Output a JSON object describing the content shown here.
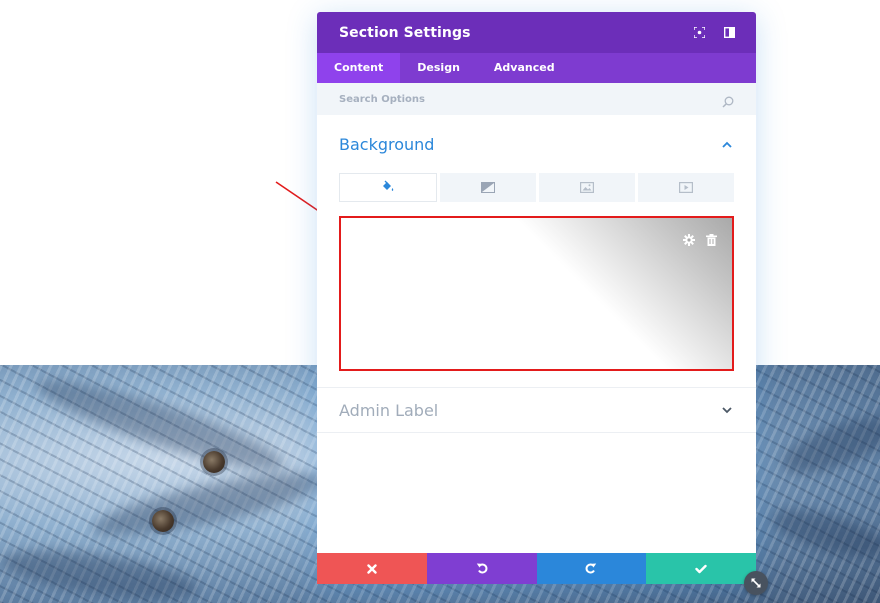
{
  "modal": {
    "title": "Section Settings",
    "tabs": [
      {
        "label": "Content",
        "active": true
      },
      {
        "label": "Design",
        "active": false
      },
      {
        "label": "Advanced",
        "active": false
      }
    ],
    "search": {
      "placeholder": "Search Options",
      "value": ""
    },
    "background_section": {
      "title": "Background",
      "type_tabs": [
        {
          "icon": "paint-bucket-icon",
          "active": true
        },
        {
          "icon": "gradient-icon",
          "active": false
        },
        {
          "icon": "image-icon",
          "active": false
        },
        {
          "icon": "video-icon",
          "active": false
        }
      ],
      "preview_tools": [
        "gear-icon",
        "trash-icon"
      ]
    },
    "admin_label_section": {
      "title": "Admin Label"
    },
    "footer": [
      "close-icon",
      "undo-icon",
      "redo-icon",
      "check-icon"
    ]
  },
  "colors": {
    "header": "#6c2eb9",
    "tabs": "#7e3bd0",
    "active_tab": "#8f42ec",
    "accent_blue": "#2b87da",
    "cancel": "#ef5555",
    "undo": "#7f3ed2",
    "redo": "#2b87da",
    "save": "#29c4a9",
    "highlight_border": "#e31b1b"
  }
}
